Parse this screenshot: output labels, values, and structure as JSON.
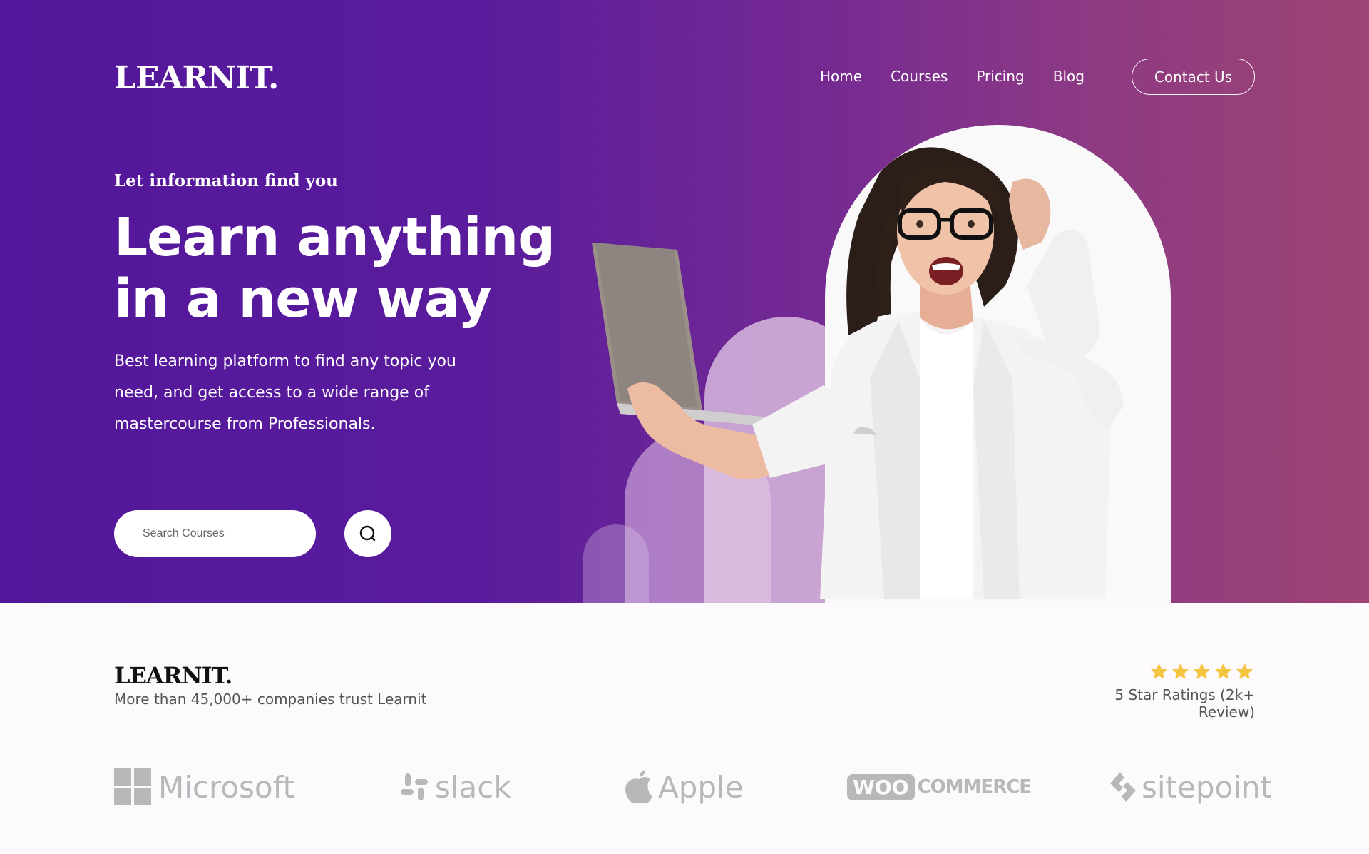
{
  "header": {
    "logo": "LEARNIT.",
    "nav": [
      "Home",
      "Courses",
      "Pricing",
      "Blog"
    ],
    "contact_label": "Contact Us"
  },
  "hero": {
    "kicker": "Let information find you",
    "headline_line1": "Learn anything",
    "headline_line2": "in a new way",
    "description": "Best learning platform to find any topic you need, and get access to a wide range of mastercourse from Professionals.",
    "search_placeholder": "Search Courses"
  },
  "trust": {
    "logo": "LEARNIT.",
    "text": "More than 45,000+ companies trust Learnit",
    "stars": 5,
    "rating_text": "5 Star Ratings (2k+ Review)"
  },
  "brands": [
    "Microsoft",
    "slack",
    "Apple",
    "COMMERCE",
    "sitepoint"
  ],
  "brand_badge": "WOO",
  "colors": {
    "hero_start": "#53179b",
    "hero_end": "#9d4473",
    "star": "#f5c542",
    "brand_gray": "#b8b8bb"
  },
  "icons": [
    "search-icon",
    "star-icon",
    "microsoft-icon",
    "slack-icon",
    "apple-icon",
    "sitepoint-icon"
  ]
}
